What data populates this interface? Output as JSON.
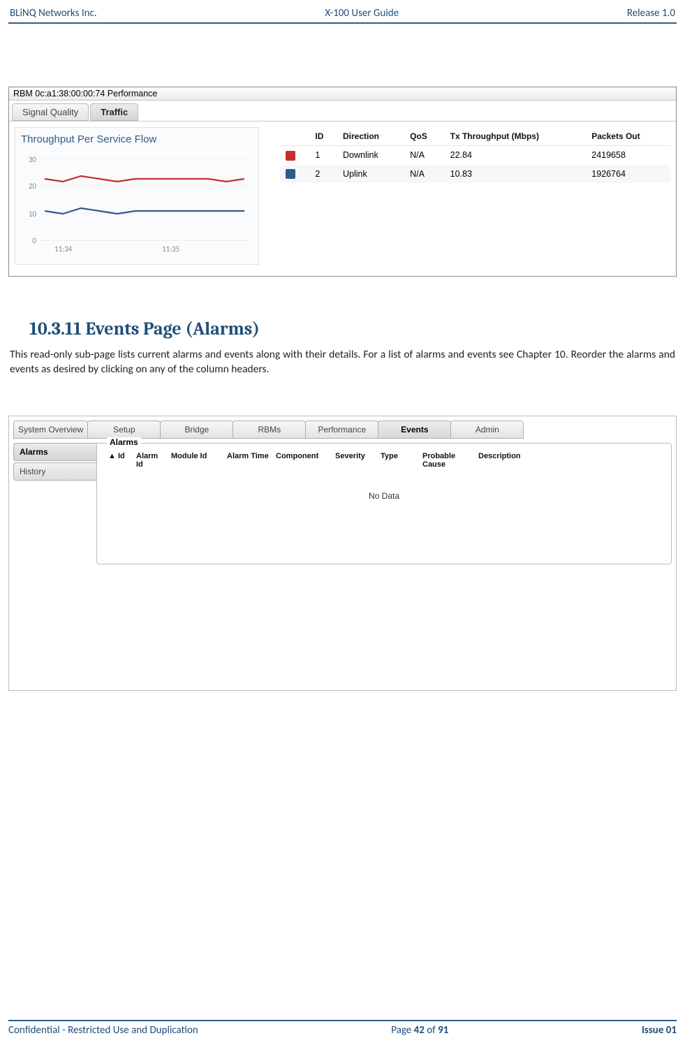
{
  "header": {
    "left": "BLiNQ Networks Inc.",
    "center": "X-100 User Guide",
    "right": "Release 1.0"
  },
  "screenshot1": {
    "window_title": "RBM 0c:a1:38:00:00:74 Performance",
    "tabs": [
      "Signal Quality",
      "Traffic"
    ],
    "active_tab": "Traffic",
    "chart_title": "Throughput Per Service Flow",
    "table": {
      "headers": [
        "",
        "ID",
        "Direction",
        "QoS",
        "Tx Throughput (Mbps)",
        "Packets Out"
      ],
      "rows": [
        {
          "color": "#C23030",
          "id": "1",
          "direction": "Downlink",
          "qos": "N/A",
          "tx": "22.84",
          "packets": "2419658"
        },
        {
          "color": "#2E5C8A",
          "id": "2",
          "direction": "Uplink",
          "qos": "N/A",
          "tx": "10.83",
          "packets": "1926764"
        }
      ]
    }
  },
  "chart_data": {
    "type": "line",
    "title": "Throughput Per Service Flow",
    "xlabel": "",
    "ylabel": "",
    "ylim": [
      0,
      30
    ],
    "y_ticks": [
      0,
      10,
      20,
      30
    ],
    "x_ticks": [
      "11:34",
      "11:35"
    ],
    "series": [
      {
        "name": "Downlink",
        "color": "#C23030",
        "values": [
          23,
          22,
          24,
          23,
          22,
          23,
          23,
          23,
          23,
          23,
          22,
          23
        ]
      },
      {
        "name": "Uplink",
        "color": "#2E5C8A",
        "values": [
          11,
          10,
          12,
          11,
          10,
          11,
          11,
          11,
          11,
          11,
          11,
          11
        ]
      }
    ]
  },
  "section": {
    "heading": "10.3.11 Events Page (Alarms)",
    "body": "This read-only sub-page lists current alarms and events along with their details. For a list of alarms and events see Chapter 10. Reorder the alarms and events as desired by clicking on any of the column headers."
  },
  "screenshot2": {
    "top_tabs": [
      "System Overview",
      "Setup",
      "Bridge",
      "RBMs",
      "Performance",
      "Events",
      "Admin"
    ],
    "active_top_tab": "Events",
    "side_tabs": [
      "Alarms",
      "History"
    ],
    "active_side_tab": "Alarms",
    "fieldset_label": "Alarms",
    "columns": [
      "▲ Id",
      "Alarm Id",
      "Module Id",
      "Alarm Time",
      "Component",
      "Severity",
      "Type",
      "Probable Cause",
      "Description"
    ],
    "nodata": "No Data"
  },
  "footer": {
    "left": "Confidential - Restricted Use and Duplication",
    "center_prefix": "Page ",
    "center_page": "42",
    "center_mid": " of ",
    "center_total": "91",
    "right": "Issue 01"
  }
}
